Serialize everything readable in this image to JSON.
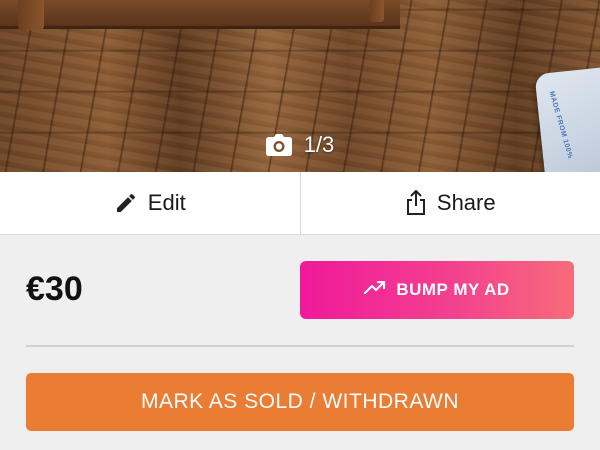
{
  "photo": {
    "counter": "1/3",
    "icon": "camera-icon",
    "bag_text": "MADE FROM 100%"
  },
  "actions": {
    "edit_label": "Edit",
    "edit_icon": "pencil-icon",
    "share_label": "Share",
    "share_icon": "share-icon"
  },
  "listing": {
    "price": "€30",
    "bump_label": "BUMP MY AD",
    "bump_icon": "trending-up-icon",
    "mark_sold_label": "MARK AS SOLD / WITHDRAWN"
  },
  "colors": {
    "bump_gradient_start": "#f0199a",
    "bump_gradient_end": "#f86b7a",
    "mark_sold": "#ea7c33",
    "background": "#efefef"
  }
}
